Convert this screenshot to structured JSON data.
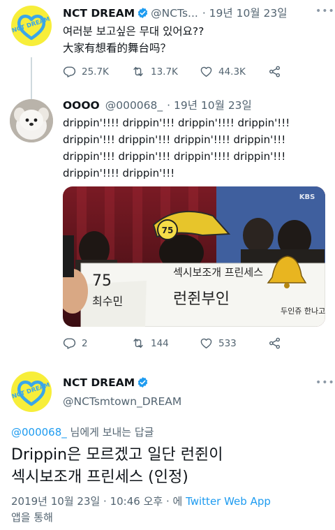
{
  "colors": {
    "accent": "#1d9bf0",
    "secondary_text": "#536471",
    "nct_yellow": "#f7ee3a",
    "nct_blue": "#3aa6e8",
    "verified": "#1d9bf0"
  },
  "tweet1": {
    "avatar_text": "NCT DREAM",
    "name": "NCT DREAM",
    "handle": "@NCTs...",
    "time": "· 19년 10월 23일",
    "text": "여러분 보고싶은 무대 있어요??\n大家有想看的舞台吗？",
    "replies": "25.7K",
    "retweets": "13.7K",
    "likes": "44.3K"
  },
  "tweet2": {
    "name": "OOOO",
    "handle": "@000068_",
    "time": "· 19년 10월 23일",
    "text": "drippin'!!!! drippin'!!! drippin'!!!! drippin'!!!\ndrippin'!!! drippin'!!! drippin'!!!! drippin'!!!\ndrippin'!!! drippin'!!! drippin'!!!! drippin'!!!\ndrippin'!!!! drippin'!!!",
    "media": {
      "broadcaster": "KBS",
      "cap_number": "75",
      "sign_number": "75",
      "sign_title": "섹시보조개 프린세스",
      "sign_left": "최수민",
      "sign_right": "런쥔부인",
      "sign_corner": "두인쥬 한나고"
    },
    "replies": "2",
    "retweets": "144",
    "likes": "533"
  },
  "tweet3": {
    "avatar_text": "NCT DREAM",
    "name": "NCT DREAM",
    "handle": "@NCTsmtown_DREAM",
    "reply_mention": "@000068_",
    "reply_suffix": " 님에게 보내는 답글",
    "text": "Drippin은 모르겠고 일단 런쥔이\n섹시보조개 프린세스 (인정)",
    "timestamp": "2019년 10월 23일 · 10:46 오후 · 에 ",
    "source": "Twitter Web App",
    "source_suffix": "앱을 통해"
  }
}
